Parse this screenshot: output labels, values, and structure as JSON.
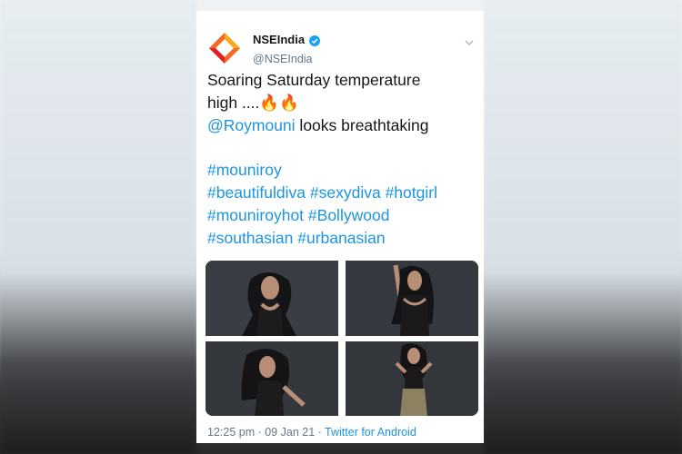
{
  "tweet": {
    "author_name": "NSEIndia",
    "author_handle": "@NSEIndia",
    "text_line1": "Soaring Saturday temperature",
    "text_line2": "high ....",
    "fire_emoji": "🔥🔥",
    "mention": "@Roymouni",
    "mention_rest": " looks breathtaking",
    "hashtags": [
      [
        "#mouniroy"
      ],
      [
        "#beautifuldiva",
        "#sexydiva",
        "#hotgirl"
      ],
      [
        "#mouniroyhot",
        "#Bollywood"
      ],
      [
        "#southasian",
        "#urbanasian"
      ]
    ],
    "time": "12:25 pm",
    "date": "09 Jan 21",
    "source": "Twitter for Android",
    "separator": " · "
  },
  "colors": {
    "link": "#1b95e0",
    "text": "#14171a",
    "muted": "#657786",
    "logo_orange": "#f26b21",
    "logo_red": "#e21e26",
    "logo_yellow": "#f9a81a"
  },
  "photos": [
    {
      "icon": "photo-woman-hair-flowing"
    },
    {
      "icon": "photo-woman-arm-raised"
    },
    {
      "icon": "photo-woman-hand-on-hip"
    },
    {
      "icon": "photo-woman-skirt"
    }
  ]
}
